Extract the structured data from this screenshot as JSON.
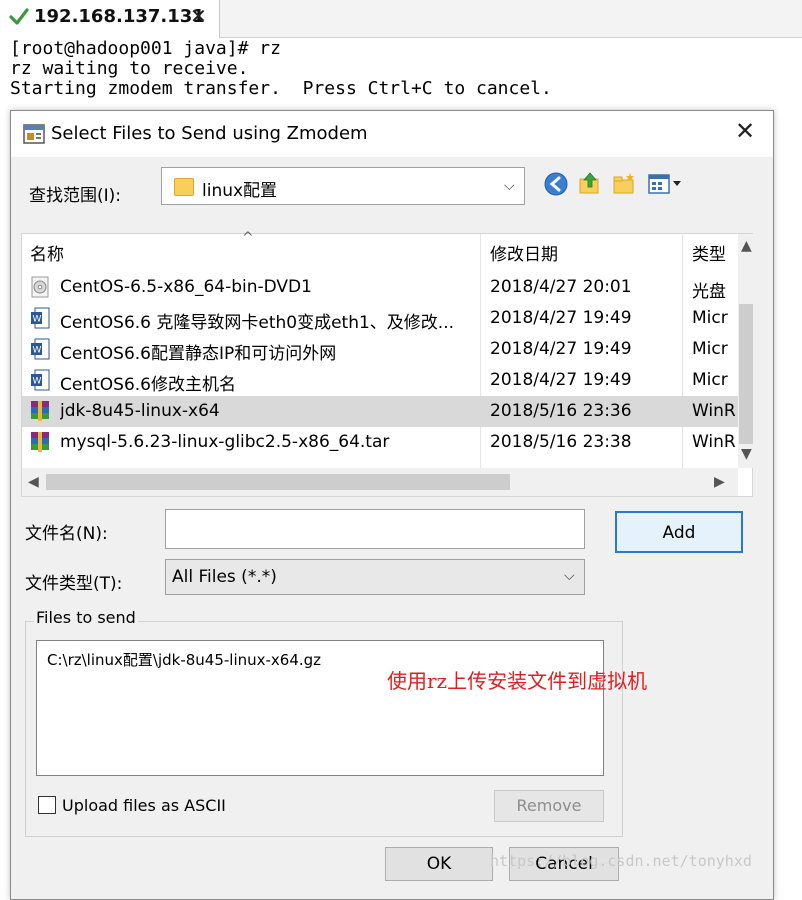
{
  "tab": {
    "title": "192.168.137.131",
    "close": "✕"
  },
  "terminal": {
    "lines": [
      "[root@hadoop001 java]# rz",
      "rz waiting to receive.",
      "Starting zmodem transfer.  Press Ctrl+C to cancel."
    ]
  },
  "dialog": {
    "title": "Select Files to Send using Zmodem",
    "close": "✕",
    "lookin_label": "查找范围(I):",
    "lookin_value": "linux配置",
    "columns": {
      "name": "名称",
      "modified": "修改日期",
      "type": "类型"
    },
    "files": [
      {
        "name": "CentOS-6.5-x86_64-bin-DVD1",
        "modified": "2018/4/27 20:01",
        "type": "光盘",
        "icon": "disc-icon"
      },
      {
        "name": "CentOS6.6 克隆导致网卡eth0变成eth1、及修改...",
        "modified": "2018/4/27 19:49",
        "type": "Micr",
        "icon": "word-doc-icon"
      },
      {
        "name": "CentOS6.6配置静态IP和可访问外网",
        "modified": "2018/4/27 19:49",
        "type": "Micr",
        "icon": "word-doc-icon"
      },
      {
        "name": "CentOS6.6修改主机名",
        "modified": "2018/4/27 19:49",
        "type": "Micr",
        "icon": "word-doc-icon"
      },
      {
        "name": "jdk-8u45-linux-x64",
        "modified": "2018/5/16 23:36",
        "type": "WinR",
        "icon": "archive-icon",
        "selected": true
      },
      {
        "name": "mysql-5.6.23-linux-glibc2.5-x86_64.tar",
        "modified": "2018/5/16 23:38",
        "type": "WinR",
        "icon": "archive-icon"
      }
    ],
    "filename_label": "文件名(N):",
    "filename_value": "",
    "filetype_label": "文件类型(T):",
    "filetype_value": "All Files (*.*)",
    "add_button": "Add",
    "files_to_send_label": "Files to send",
    "files_to_send": [
      "C:\\rz\\linux配置\\jdk-8u45-linux-x64.gz"
    ],
    "upload_ascii_label": "Upload files as ASCII",
    "remove_button": "Remove",
    "ok_button": "OK",
    "cancel_button": "Cancel"
  },
  "annotation": "使用rz上传安装文件到虚拟机",
  "watermark": "https://blog.csdn.net/tonyhxd",
  "colors": {
    "accent": "#2b78d0",
    "annotation": "#e02020",
    "selection": "#d9d9d9"
  }
}
